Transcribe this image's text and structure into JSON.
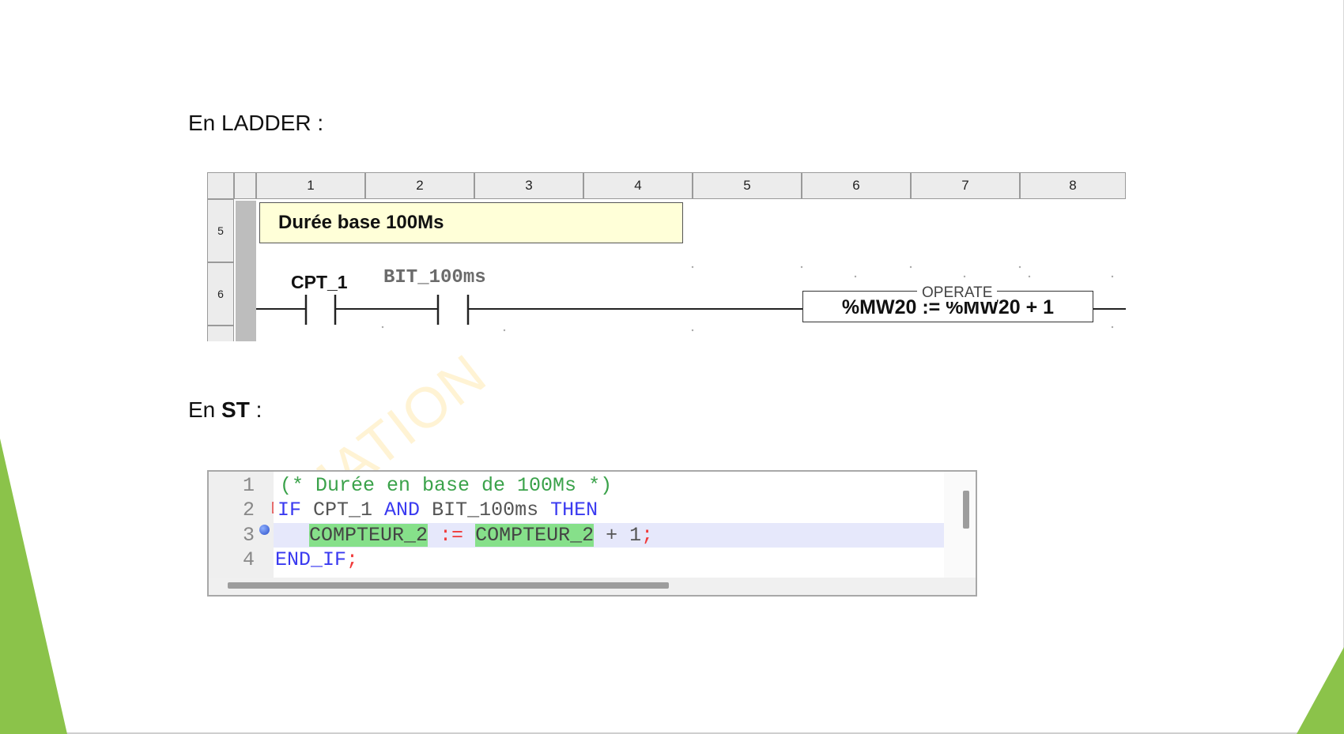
{
  "slide": {
    "ladder_heading_prefix": "En LADDER :",
    "st_heading_prefix": "En ",
    "st_heading_bold": "ST",
    "st_heading_suffix": " :",
    "watermark": "MATION",
    "accent_color": "#8bc34a"
  },
  "ladder": {
    "columns": [
      "1",
      "2",
      "3",
      "4",
      "5",
      "6",
      "7",
      "8"
    ],
    "rows": [
      "5",
      "6"
    ],
    "comment": "Durée base 100Ms",
    "contact1_label": "CPT_1",
    "contact2_label": "BIT_100ms",
    "operate_title": "OPERATE",
    "operate_expression": "%MW20 := %MW20 + 1"
  },
  "st": {
    "line_numbers": [
      "1",
      "2",
      "3",
      "4"
    ],
    "line1_comment": "(* Durée en base de 100Ms *)",
    "line2_if": "IF",
    "line2_var1": " CPT_1 ",
    "line2_and": "AND",
    "line2_var2": " BIT_100ms ",
    "line2_then": "THEN",
    "line3_indent": "   ",
    "line3_lhs": "COMPTEUR_2",
    "line3_assign": " := ",
    "line3_rhs": "COMPTEUR_2",
    "line3_plus": " + 1",
    "line3_semicolon": ";",
    "line4_end": "END_IF",
    "line4_semicolon": ";"
  }
}
